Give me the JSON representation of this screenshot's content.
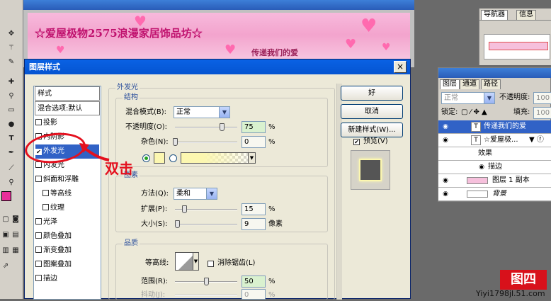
{
  "toolbox": {
    "tools": [
      "move-icon",
      "wand-icon",
      "brush-icon",
      "eraser-icon",
      "text-icon",
      "pen-icon",
      "eyedropper-icon",
      "zoom-icon",
      "hand-icon"
    ]
  },
  "canvas": {
    "banner_title": "☆爱屋极物2575浪漫家居饰品坊☆",
    "banner_sub": "传递我们的爱"
  },
  "nav_panel": {
    "tabs": [
      "导航器",
      "信息"
    ]
  },
  "layers_panel": {
    "tabs": [
      "图层",
      "通道",
      "路径"
    ],
    "blend_mode": "正常",
    "opacity_label": "不透明度:",
    "opacity_value": "100",
    "lock_label": "锁定:",
    "fill_label": "填充:",
    "fill_value": "100",
    "rows": [
      {
        "name": "传递我们的爱",
        "thumb": "T",
        "selected": true
      },
      {
        "name": "☆爱屋极...",
        "thumb": "T",
        "selected": false
      },
      {
        "name": "效果",
        "thumb": "",
        "selected": false
      },
      {
        "name": "描边",
        "thumb": "",
        "selected": false
      },
      {
        "name": "图层 1 副本",
        "thumb": "",
        "selected": false
      },
      {
        "name": "背景",
        "thumb": "",
        "selected": false
      }
    ]
  },
  "watermark": {
    "logo": "图四",
    "url": "Yiyi1798jl.51.com"
  },
  "dialog": {
    "title": "图层样式",
    "close": "×",
    "style_list": {
      "header": "样式",
      "blend_options": "混合选项:默认",
      "items": [
        {
          "label": "投影",
          "checked": false,
          "selected": false,
          "indent": false
        },
        {
          "label": "内阴影",
          "checked": false,
          "selected": false,
          "indent": false
        },
        {
          "label": "外发光",
          "checked": true,
          "selected": true,
          "indent": false
        },
        {
          "label": "内发光",
          "checked": false,
          "selected": false,
          "indent": false
        },
        {
          "label": "斜面和浮雕",
          "checked": false,
          "selected": false,
          "indent": false
        },
        {
          "label": "等高线",
          "checked": false,
          "selected": false,
          "indent": true
        },
        {
          "label": "纹理",
          "checked": false,
          "selected": false,
          "indent": true
        },
        {
          "label": "光泽",
          "checked": false,
          "selected": false,
          "indent": false
        },
        {
          "label": "颜色叠加",
          "checked": false,
          "selected": false,
          "indent": false
        },
        {
          "label": "渐变叠加",
          "checked": false,
          "selected": false,
          "indent": false
        },
        {
          "label": "图案叠加",
          "checked": false,
          "selected": false,
          "indent": false
        },
        {
          "label": "描边",
          "checked": false,
          "selected": false,
          "indent": false
        }
      ]
    },
    "outer_glow": {
      "section_title": "外发光",
      "structure": {
        "title": "结构",
        "blend_label": "混合模式(B):",
        "blend_value": "正常",
        "opacity_label": "不透明度(O):",
        "opacity_value": "75",
        "opacity_percent": 75,
        "noise_label": "杂色(N):",
        "noise_value": "0",
        "noise_percent": 0,
        "unit": "%",
        "glow_color": "#fcf7b0"
      },
      "elements": {
        "title": "图素",
        "method_label": "方法(Q):",
        "method_value": "柔和",
        "spread_label": "扩展(P):",
        "spread_value": "15",
        "spread_percent": 15,
        "size_label": "大小(S):",
        "size_value": "9",
        "size_fraction": 0.036,
        "size_unit": "像素"
      },
      "quality": {
        "title": "品质",
        "contour_label": "等高线:",
        "antialias_label": "消除锯齿(L)",
        "antialias_checked": false,
        "range_label": "范围(R):",
        "range_value": "50",
        "range_percent": 50,
        "jitter_label": "抖动(J):",
        "jitter_value": "0"
      }
    },
    "buttons": {
      "ok": "好",
      "cancel": "取消",
      "new_style": "新建样式(W)...",
      "preview_label": "预览(V)",
      "preview_checked": true
    }
  },
  "annotation": {
    "text": "双击"
  },
  "colors": {
    "accent": "#3162c6",
    "annotation": "#e4101e",
    "foreground_swatch": "#e8309a"
  }
}
